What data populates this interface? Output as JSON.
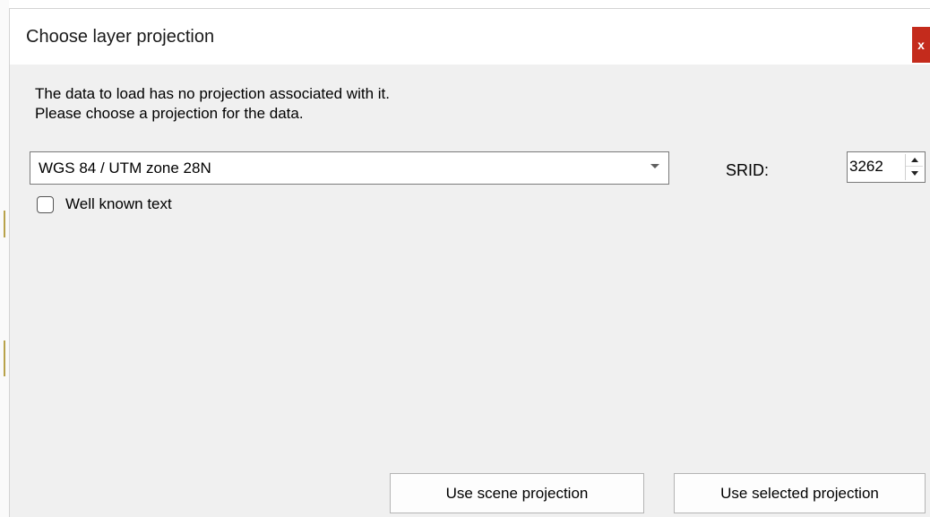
{
  "dialog": {
    "title": "Choose layer projection",
    "close_label": "x"
  },
  "message": {
    "line1": "The data to load has no projection associated with it.",
    "line2": "Please choose a projection for the data."
  },
  "projection_select": {
    "value": "WGS 84 / UTM zone 28N"
  },
  "srid": {
    "label": "SRID:",
    "value": "3262"
  },
  "wkt_checkbox": {
    "label": "Well known text",
    "checked": false
  },
  "buttons": {
    "use_scene": "Use scene projection",
    "use_selected": "Use selected projection"
  },
  "colors": {
    "close_bg": "#c42b1c",
    "dialog_bg": "#f0f0f0",
    "titlebar_bg": "#ffffff"
  }
}
